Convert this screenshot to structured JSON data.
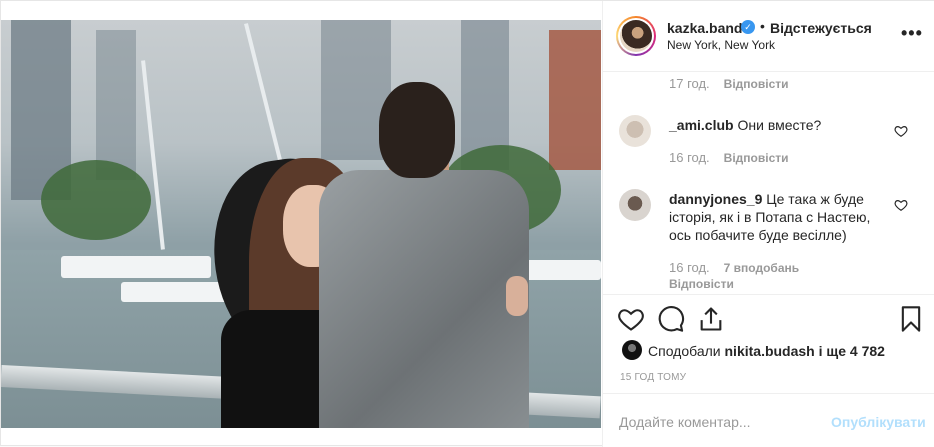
{
  "header": {
    "username": "kazka.band",
    "dot": "•",
    "follow_label": "Відстежується",
    "location": "New York, New York",
    "more_icon": "more-horizontal-icon"
  },
  "comments": [
    {
      "time": "17 год.",
      "reply": "Відповісти"
    },
    {
      "user": "_ami.club",
      "text": "Они вместе?",
      "time": "16 год.",
      "reply": "Відповісти"
    },
    {
      "user": "dannyjones_9",
      "text": "Це така ж буде історія, як і в Потапа с Настею, ось побачите буде весілле)",
      "time": "16 год.",
      "likes": "7 вподобань",
      "reply": "Відповісти"
    }
  ],
  "likes": {
    "prefix": "Сподобали",
    "user": "nikita.budash",
    "suffix": "і ще 4 782"
  },
  "time_ago": "15 ГОД ТОМУ",
  "comment_box": {
    "placeholder": "Додайте коментар...",
    "post_label": "Опублікувати"
  },
  "colors": {
    "verified": "#3897f0",
    "post_button": "#b2dffc",
    "meta": "#999999"
  }
}
